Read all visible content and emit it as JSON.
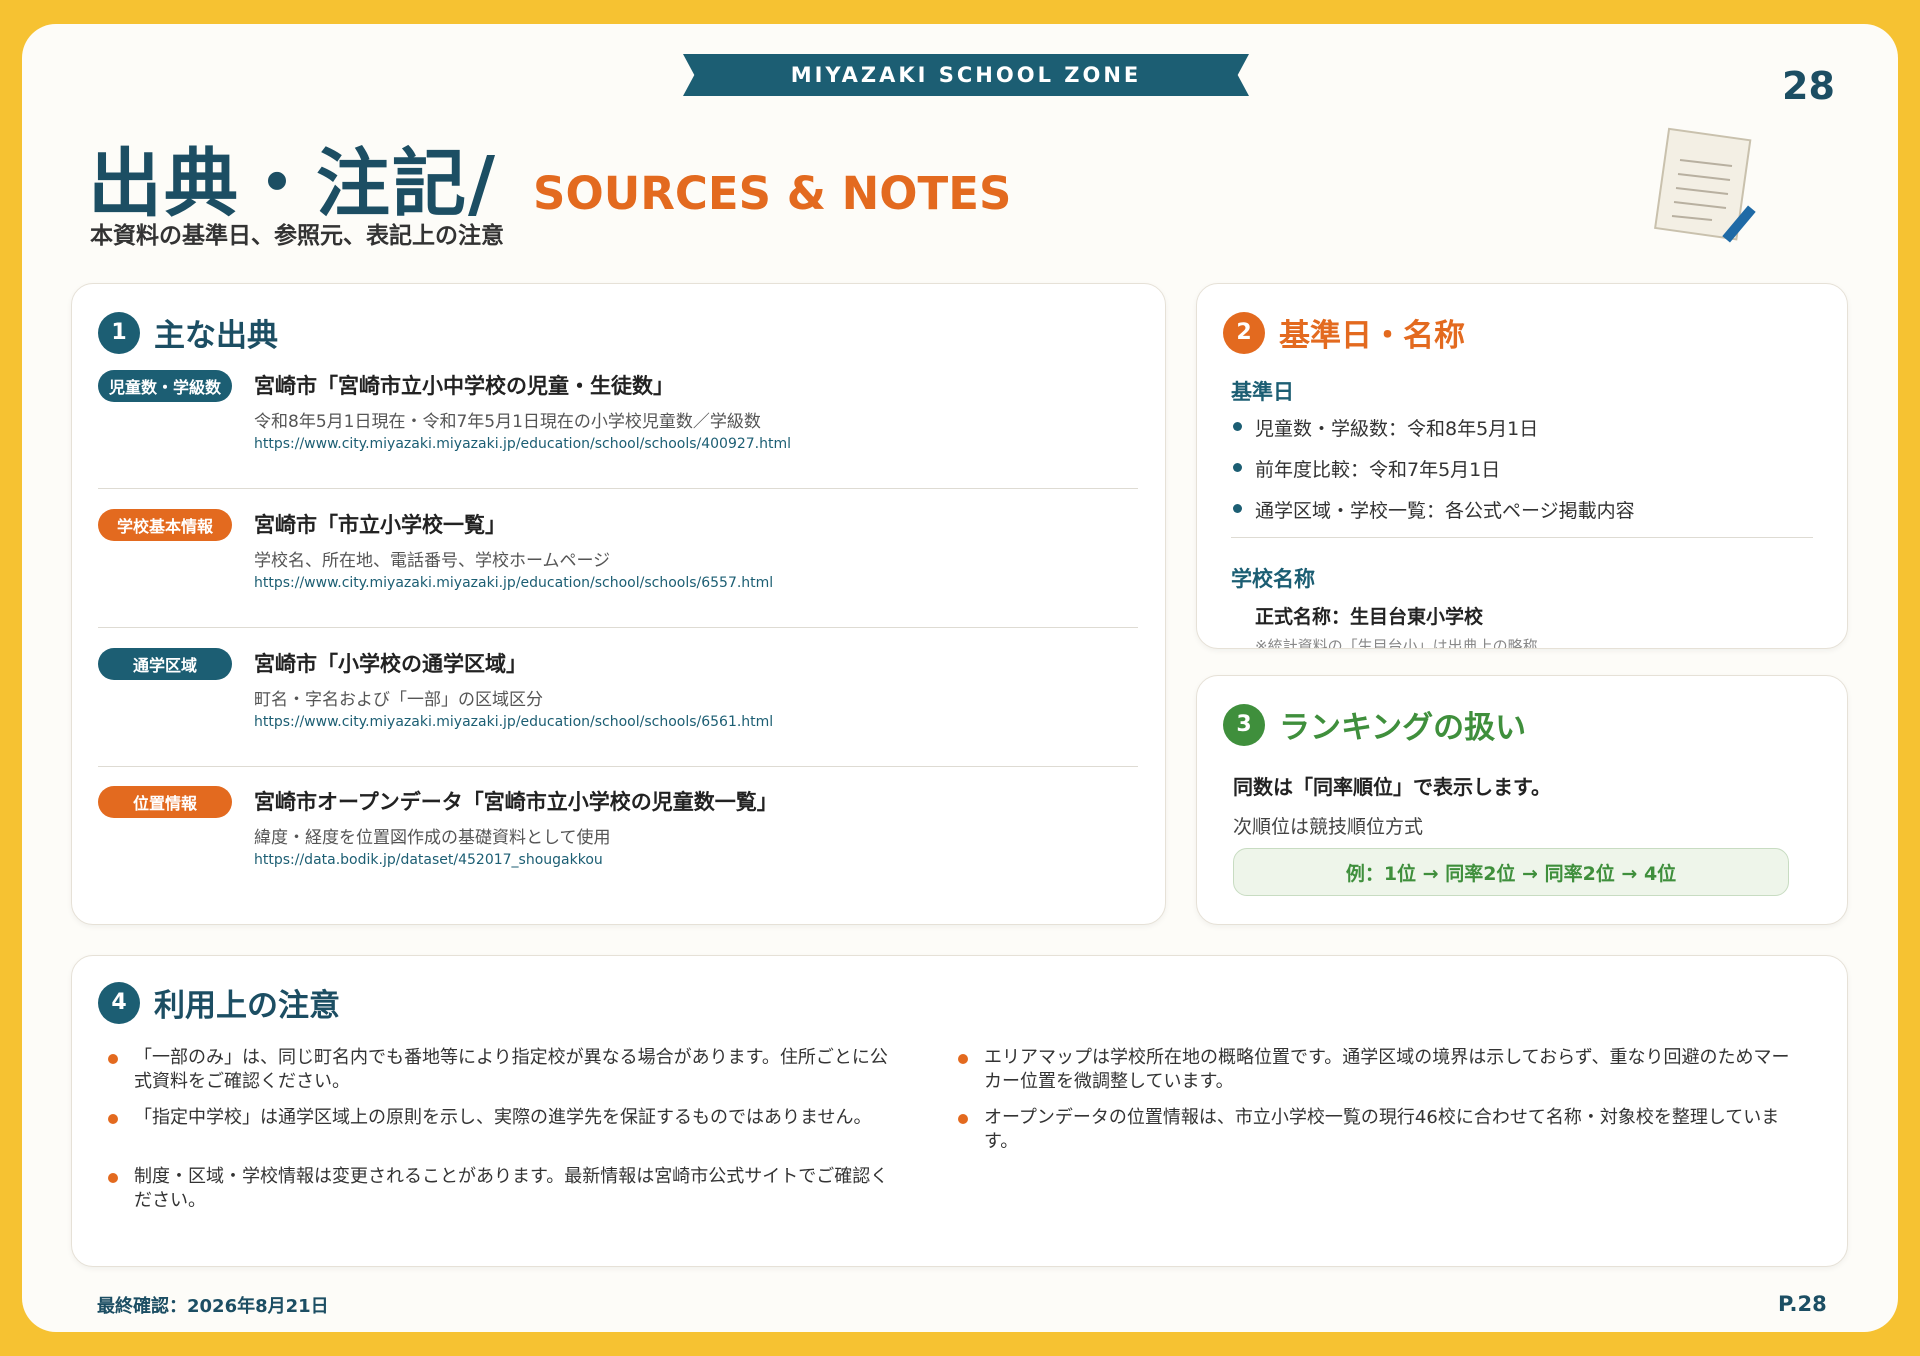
{
  "banner": "MIYAZAKI SCHOOL ZONE",
  "page_number": "28",
  "title_jp": "出典・注記/",
  "title_en": "SOURCES & NOTES",
  "subtitle": "本資料の基準日、参照元、表記上の注意",
  "colors": {
    "teal": "#1c5e73",
    "orange": "#e36a1f",
    "green": "#3f8f3c"
  },
  "sources": {
    "num": "1",
    "title": "主な出典",
    "items": [
      {
        "tag": "児童数・学級数",
        "tag_color": "#1c5e73",
        "title": "宮崎市「宮崎市立小中学校の児童・生徒数」",
        "desc": "令和8年5月1日現在・令和7年5月1日現在の小学校児童数／学級数",
        "url": "https://www.city.miyazaki.miyazaki.jp/education/school/schools/400927.html"
      },
      {
        "tag": "学校基本情報",
        "tag_color": "#e36a1f",
        "title": "宮崎市「市立小学校一覧」",
        "desc": "学校名、所在地、電話番号、学校ホームページ",
        "url": "https://www.city.miyazaki.miyazaki.jp/education/school/schools/6557.html"
      },
      {
        "tag": "通学区域",
        "tag_color": "#1c5e73",
        "title": "宮崎市「小学校の通学区域」",
        "desc": "町名・字名および「一部」の区域区分",
        "url": "https://www.city.miyazaki.miyazaki.jp/education/school/schools/6561.html"
      },
      {
        "tag": "位置情報",
        "tag_color": "#e36a1f",
        "title": "宮崎市オープンデータ「宮崎市立小学校の児童数一覧」",
        "desc": "緯度・経度を位置図作成の基礎資料として使用",
        "url": "https://data.bodik.jp/dataset/452017_shougakkou"
      }
    ]
  },
  "basis": {
    "num": "2",
    "title": "基準日・名称",
    "date_heading": "基準日",
    "date_items": [
      "児童数・学級数：令和8年5月1日",
      "前年度比較：令和7年5月1日",
      "通学区域・学校一覧：各公式ページ掲載内容"
    ],
    "name_heading": "学校名称",
    "official_name": "正式名称：生目台東小学校",
    "name_note": "※統計資料の「生目台小」は出典上の略称"
  },
  "ranking": {
    "num": "3",
    "title": "ランキングの扱い",
    "line1": "同数は「同率順位」で表示します。",
    "line2": "次順位は競技順位方式",
    "example": "例：1位 → 同率2位 → 同率2位 → 4位"
  },
  "notes": {
    "num": "4",
    "title": "利用上の注意",
    "left": [
      "「一部のみ」は、同じ町名内でも番地等により指定校が異なる場合があります。住所ごとに公式資料をご確認ください。",
      "「指定中学校」は通学区域上の原則を示し、実際の進学先を保証するものではありません。",
      "制度・区域・学校情報は変更されることがあります。最新情報は宮崎市公式サイトでご確認ください。"
    ],
    "right": [
      "エリアマップは学校所在地の概略位置です。通学区域の境界は示しておらず、重なり回避のためマーカー位置を微調整しています。",
      "オープンデータの位置情報は、市立小学校一覧の現行46校に合わせて名称・対象校を整理しています。"
    ]
  },
  "footer_left": "最終確認：2026年8月21日",
  "footer_right": "P.28",
  "icons": {
    "deco": "notepad-pencil-icon"
  }
}
